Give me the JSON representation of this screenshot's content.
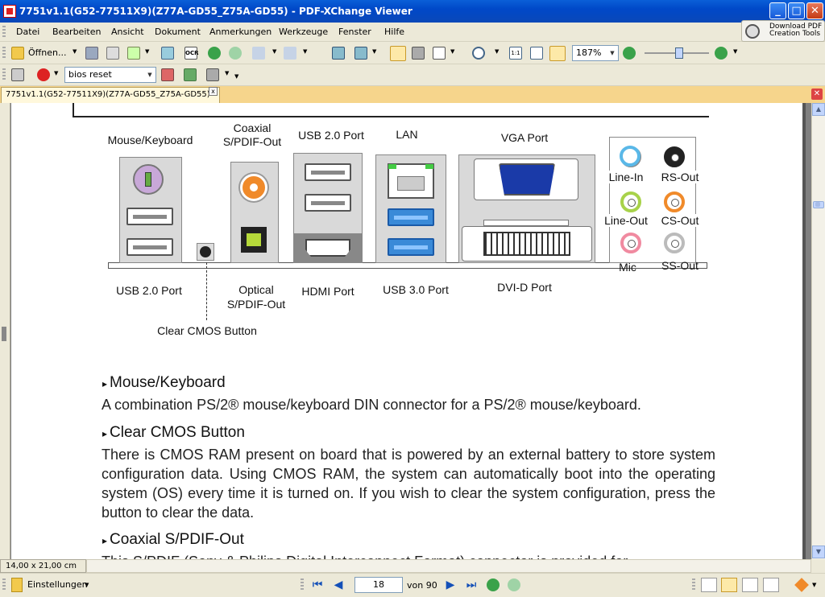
{
  "window": {
    "title": "7751v1.1(G52-77511X9)(Z77A-GD55_Z75A-GD55) - PDF-XChange Viewer",
    "controls": {
      "minimize": "_",
      "maximize": "□",
      "close": "✕"
    }
  },
  "menu": [
    "Datei",
    "Bearbeiten",
    "Ansicht",
    "Dokument",
    "Anmerkungen",
    "Werkzeuge",
    "Fenster",
    "Hilfe"
  ],
  "download_button": {
    "line1": "Download PDF",
    "line2": "Creation Tools"
  },
  "toolbar1": {
    "open_label": "Öffnen...",
    "ocr_label": "OCR",
    "zoom_value": "187%",
    "actual_size_label": "1:1"
  },
  "toolbar2": {
    "search_value": "bios reset"
  },
  "tab": {
    "label": "7751v1.1(G52-77511X9)(Z77A-GD55_Z75A-GD55)",
    "close": "x"
  },
  "page_size": "14,00 x 21,00 cm",
  "status": {
    "settings_label": "Einstellungen",
    "current_page": "18",
    "of_label": "von 90"
  },
  "diagram": {
    "labels": {
      "mouse_keyboard": "Mouse/Keyboard",
      "coaxial_1": "Coaxial",
      "coaxial_2": "S/PDIF-Out",
      "usb20_top": "USB 2.0 Port",
      "lan": "LAN",
      "vga": "VGA Port",
      "line_in": "Line-In",
      "rs_out": "RS-Out",
      "line_out": "Line-Out",
      "cs_out": "CS-Out",
      "mic": "Mic",
      "ss_out": "SS-Out",
      "usb20_bottom": "USB 2.0 Port",
      "optical_1": "Optical",
      "optical_2": "S/PDIF-Out",
      "hdmi": "HDMI Port",
      "usb30": "USB 3.0 Port",
      "dvid": "DVI-D Port",
      "clear_cmos": "Clear CMOS Button"
    },
    "jack_colors": {
      "line_in": "#5ab8e8",
      "rs_out": "#222222",
      "line_out": "#a8d24a",
      "cs_out": "#f08a2a",
      "mic": "#f08aa0",
      "ss_out": "#bbbbbb"
    }
  },
  "sections": [
    {
      "heading": "Mouse/Keyboard",
      "text": "A combination PS/2® mouse/keyboard DIN connector for a PS/2® mouse/keyboard."
    },
    {
      "heading": "Clear CMOS Button",
      "text": "There is CMOS RAM present on board that is powered by an external battery to store system configuration data. Using CMOS RAM, the system can automatically boot into the operating system (OS) every time it is turned on. If you wish to clear the system configuration, press the button to clear the data."
    },
    {
      "heading": "Coaxial S/PDIF-Out",
      "text": "This S/PDIF (Sony & Philips Digital Interconnect Format) connector is provided for"
    }
  ]
}
